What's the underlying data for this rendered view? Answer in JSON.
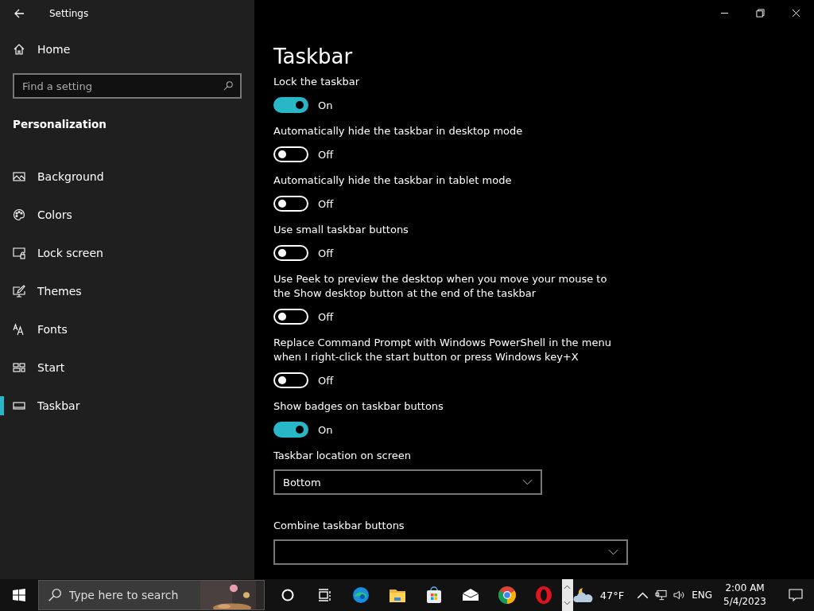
{
  "window": {
    "title": "Settings"
  },
  "sidebar": {
    "home": "Home",
    "search": {
      "placeholder": "Find a setting"
    },
    "section": "Personalization",
    "items": [
      {
        "label": "Background",
        "selected": false
      },
      {
        "label": "Colors",
        "selected": false
      },
      {
        "label": "Lock screen",
        "selected": false
      },
      {
        "label": "Themes",
        "selected": false
      },
      {
        "label": "Fonts",
        "selected": false
      },
      {
        "label": "Start",
        "selected": false
      },
      {
        "label": "Taskbar",
        "selected": true
      }
    ]
  },
  "page": {
    "title": "Taskbar",
    "settings": [
      {
        "kind": "toggle",
        "label": "Lock the taskbar",
        "on": true,
        "state_text": "On"
      },
      {
        "kind": "toggle",
        "label": "Automatically hide the taskbar in desktop mode",
        "on": false,
        "state_text": "Off"
      },
      {
        "kind": "toggle",
        "label": "Automatically hide the taskbar in tablet mode",
        "on": false,
        "state_text": "Off"
      },
      {
        "kind": "toggle",
        "label": "Use small taskbar buttons",
        "on": false,
        "state_text": "Off"
      },
      {
        "kind": "toggle",
        "label": "Use Peek to preview the desktop when you move your mouse to the Show desktop button at the end of the taskbar",
        "on": false,
        "state_text": "Off"
      },
      {
        "kind": "toggle",
        "label": "Replace Command Prompt with Windows PowerShell in the menu when I right-click the start button or press Windows key+X",
        "on": false,
        "state_text": "Off"
      },
      {
        "kind": "toggle",
        "label": "Show badges on taskbar buttons",
        "on": true,
        "state_text": "On"
      },
      {
        "kind": "dropdown",
        "label": "Taskbar location on screen",
        "value": "Bottom"
      },
      {
        "kind": "dropdown",
        "label": "Combine taskbar buttons"
      }
    ]
  },
  "taskbar": {
    "search_placeholder": "Type here to search",
    "weather": "47°F",
    "language": "ENG",
    "time": "2:00 AM",
    "date": "5/4/2023"
  }
}
